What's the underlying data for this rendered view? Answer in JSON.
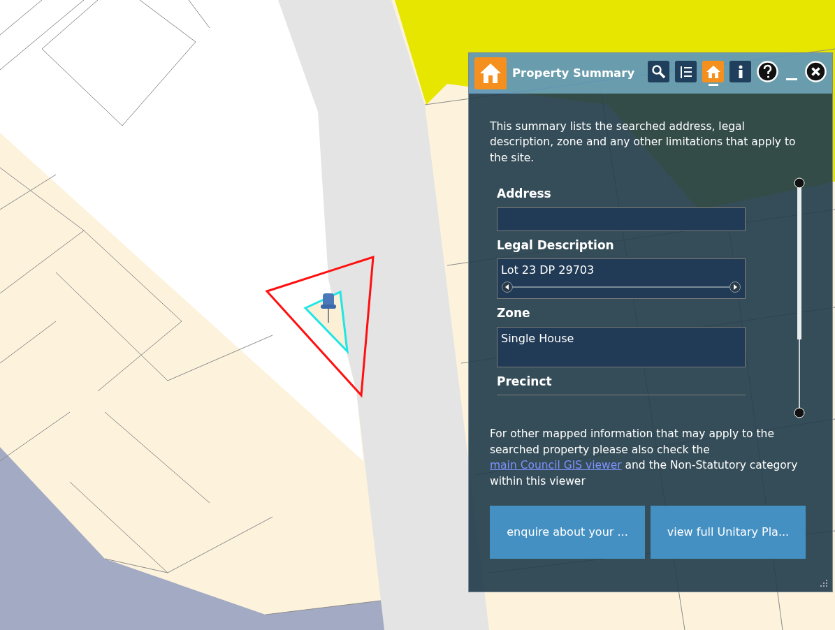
{
  "panel": {
    "title": "Property Summary",
    "tools": [
      {
        "kind": "search",
        "selected": false
      },
      {
        "kind": "list",
        "selected": false
      },
      {
        "kind": "property",
        "selected": true
      },
      {
        "kind": "info",
        "selected": false
      },
      {
        "kind": "help",
        "selected": false
      },
      {
        "kind": "minimize",
        "selected": false
      },
      {
        "kind": "close",
        "selected": false
      }
    ],
    "intro": "This summary lists the searched address, legal description, zone and any other limitations that apply to the site.",
    "fields": [
      {
        "label": "Address",
        "kind": "short"
      },
      {
        "label": "Legal Description",
        "value": "Lot 23 DP 29703",
        "kind": "hscroll"
      },
      {
        "label": "Zone",
        "value": "Single House",
        "kind": "tall"
      },
      {
        "label": "Precinct",
        "kind": "cut"
      }
    ],
    "footer": {
      "before": "For other mapped information that may apply to the searched property please also check the",
      "link": "main Council GIS viewer",
      "after": "and the Non-Statutory category within this viewer"
    },
    "buttons": [
      "enquire about your ...",
      "view full Unitary Pla..."
    ]
  }
}
